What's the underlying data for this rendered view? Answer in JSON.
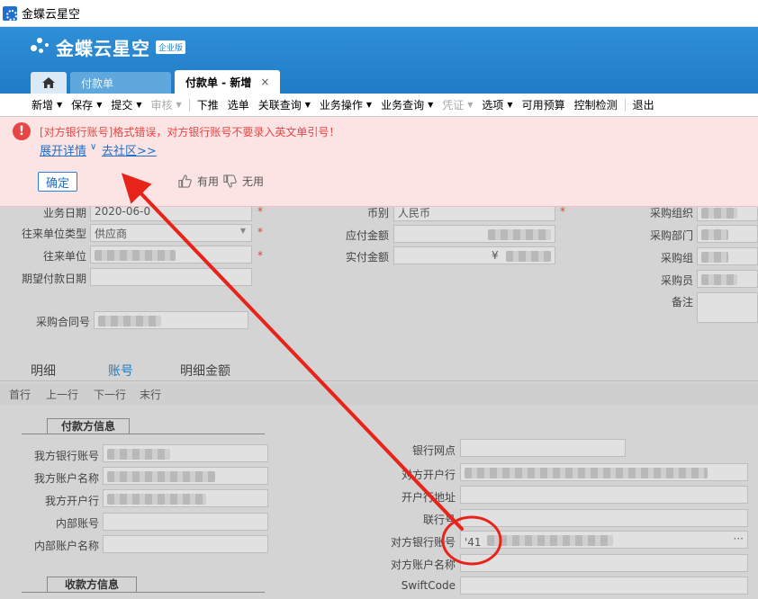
{
  "window": {
    "title": "金蝶云星空"
  },
  "header": {
    "logo_text": "金蝶云星空",
    "logo_badge": "企业版",
    "tabs": [
      {
        "label": "付款单"
      },
      {
        "label": "付款单 - 新增",
        "close": "×"
      }
    ]
  },
  "toolbar": {
    "items": [
      {
        "label": "新增",
        "dropdown": true
      },
      {
        "label": "保存",
        "dropdown": true
      },
      {
        "label": "提交",
        "dropdown": true
      },
      {
        "label": "审核",
        "dropdown": true,
        "disabled": true
      },
      {
        "label": "下推"
      },
      {
        "label": "选单"
      },
      {
        "label": "关联查询",
        "dropdown": true
      },
      {
        "label": "业务操作",
        "dropdown": true
      },
      {
        "label": "业务查询",
        "dropdown": true
      },
      {
        "label": "凭证",
        "dropdown": true,
        "disabled": true
      },
      {
        "label": "选项",
        "dropdown": true
      },
      {
        "label": "可用预算"
      },
      {
        "label": "控制检测"
      },
      {
        "label": "退出"
      }
    ]
  },
  "banner": {
    "icon": "!",
    "message": "[对方银行账号]格式错误，对方银行账号不要录入英文单引号！",
    "details_link": "展开详情",
    "community_link": "去社区>>",
    "confirm_label": "确定",
    "useful_label": "有用",
    "useless_label": "无用"
  },
  "form": {
    "labels": {
      "biz_date": "业务日期",
      "partner_type": "往来单位类型",
      "partner": "往来单位",
      "expected_date": "期望付款日期",
      "contract": "采购合同号",
      "currency": "币别",
      "payable": "应付金额",
      "actual": "实付金额",
      "purch_org": "采购组织",
      "purch_dept": "采购部门",
      "purch_group": "采购组",
      "purchaser": "采购员",
      "remark": "备注"
    },
    "values": {
      "biz_date": "2020-06-0",
      "partner_type": "供应商",
      "currency": "人民币",
      "actual_prefix": "¥"
    },
    "required_mark": "*"
  },
  "subtabs": [
    "明细",
    "账号",
    "明细金额"
  ],
  "navbar": [
    "首行",
    "上一行",
    "下一行",
    "末行"
  ],
  "account": {
    "payer_title": "付款方信息",
    "payee_title": "收款方信息",
    "left_labels": [
      "我方银行账号",
      "我方账户名称",
      "我方开户行",
      "内部账号",
      "内部账户名称"
    ],
    "right_labels": [
      "银行网点",
      "对方开户行",
      "开户行地址",
      "联行号",
      "对方银行账号",
      "对方账户名称",
      "SwiftCode"
    ],
    "counterparty_account_value": "'41",
    "ellipsis": "···"
  },
  "colors": {
    "header_blue": "#1f7dc6",
    "error_red": "#e84545",
    "banner_bg": "#fde4e4",
    "annotation_red": "#e8231a"
  }
}
